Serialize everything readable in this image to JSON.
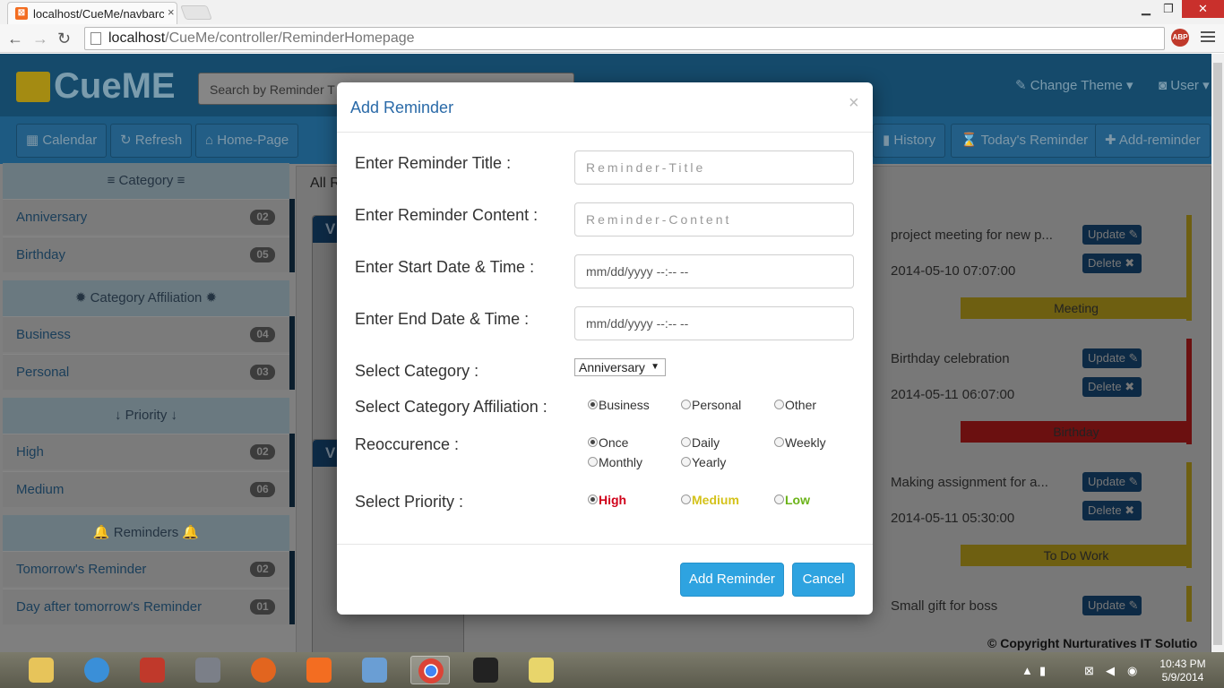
{
  "browser": {
    "tab_title": "localhost/CueMe/navbarc",
    "tab_close": "×",
    "url_host": "localhost",
    "url_path": "/CueMe/controller/ReminderHomepage",
    "abp": "ABP",
    "window_buttons": {
      "minimize": "▁",
      "restore": "❐",
      "close": "✕"
    }
  },
  "header": {
    "logo": "CueME",
    "search_placeholder": "Search by Reminder T",
    "change_theme": "Change Theme ▾",
    "user": "User ▾"
  },
  "toolbar": {
    "calendar": "Calendar",
    "refresh": "Refresh",
    "home": "Home-Page",
    "history": "History",
    "today": "Today's Reminder",
    "add": "Add-reminder"
  },
  "sidebar": {
    "category_head": "≡ Category ≡",
    "category": [
      {
        "label": "Anniversary",
        "count": "02"
      },
      {
        "label": "Birthday",
        "count": "05"
      }
    ],
    "affiliation_head": "✹ Category Affiliation ✹",
    "affiliation": [
      {
        "label": "Business",
        "count": "04"
      },
      {
        "label": "Personal",
        "count": "03"
      }
    ],
    "priority_head": "↓ Priority ↓",
    "priority": [
      {
        "label": "High",
        "count": "02"
      },
      {
        "label": "Medium",
        "count": "06"
      }
    ],
    "reminders_head": "🔔 Reminders 🔔",
    "reminders": [
      {
        "label": "Tomorrow's Reminder",
        "count": "02"
      },
      {
        "label": "Day after tomorrow's Reminder",
        "count": "01"
      }
    ]
  },
  "main": {
    "all_label": "All R",
    "sub_a_letter": "V",
    "sub_b_letter": "V",
    "cards": [
      {
        "title": "project meeting for new p...",
        "date": "2014-05-10 07:07:00",
        "tag": "Meeting",
        "color": "#6e5f11",
        "bar": "#6e5f11"
      },
      {
        "title": "Birthday celebration",
        "date": "2014-05-11 06:07:00",
        "tag": "Birthday",
        "color": "#6b1010",
        "bar": "#6b1010"
      },
      {
        "title": "Making assignment for a...",
        "date": "2014-05-11 05:30:00",
        "tag": "To Do Work",
        "color": "#6e5f11",
        "bar": "#6e5f11"
      },
      {
        "title": "Small gift for boss",
        "date": "",
        "tag": "",
        "color": "",
        "bar": "#6e5f11"
      }
    ],
    "update_label": "Update ✎",
    "delete_label": "Delete ✖",
    "copyright": "© Copyright Nurturatives IT Solutio"
  },
  "modal": {
    "title": "Add Reminder",
    "close": "×",
    "labels": {
      "title": "Enter Reminder Title :",
      "content": "Enter Reminder Content :",
      "start": "Enter Start Date & Time :",
      "end": "Enter End Date & Time :",
      "category": "Select Category :",
      "affiliation": "Select Category Affiliation :",
      "recurrence": "Reoccurence :",
      "priority": "Select Priority :"
    },
    "placeholders": {
      "title": "Reminder-Title",
      "content": "Reminder-Content",
      "start": "mm/dd/yyyy --:-- --",
      "end": "mm/dd/yyyy --:-- --"
    },
    "category_value": "Anniversary",
    "affiliation_options": [
      "Business",
      "Personal",
      "Other"
    ],
    "affiliation_selected": "Business",
    "recurrence_options": [
      "Once",
      "Daily",
      "Weekly",
      "Monthly",
      "Yearly"
    ],
    "recurrence_selected": "Once",
    "priority_options": [
      {
        "label": "High",
        "color": "#d0021b"
      },
      {
        "label": "Medium",
        "color": "#d4c21a"
      },
      {
        "label": "Low",
        "color": "#6bb318"
      }
    ],
    "priority_selected": "High",
    "add_button": "Add Reminder",
    "cancel_button": "Cancel"
  },
  "taskbar": {
    "time": "10:43 PM",
    "date": "5/9/2014",
    "icons": [
      "file-explorer-icon",
      "internet-explorer-icon",
      "filezilla-icon",
      "firewall-icon",
      "firefox-icon",
      "xampp-icon",
      "virtualbox-icon",
      "chrome-icon",
      "blackberry-icon",
      "star-app-icon"
    ]
  }
}
